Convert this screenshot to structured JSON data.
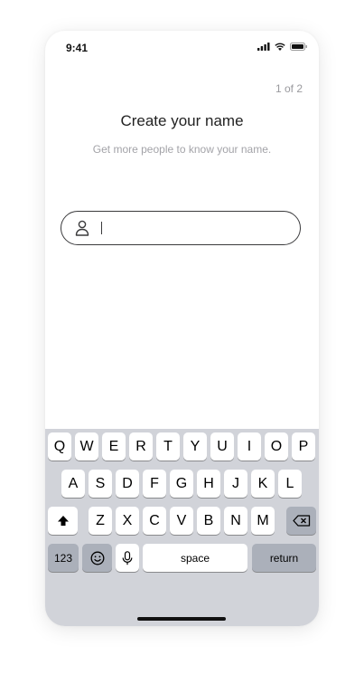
{
  "status_bar": {
    "time": "9:41",
    "icons": [
      "cellular-signal-icon",
      "wifi-icon",
      "battery-icon"
    ]
  },
  "header": {
    "step": "1 of 2"
  },
  "content": {
    "title": "Create your name",
    "subtitle": "Get more people to know your name."
  },
  "name_input": {
    "icon": "person-icon",
    "value": ""
  },
  "keyboard": {
    "row1": [
      "Q",
      "W",
      "E",
      "R",
      "T",
      "Y",
      "U",
      "I",
      "O",
      "P"
    ],
    "row2": [
      "A",
      "S",
      "D",
      "F",
      "G",
      "H",
      "J",
      "K",
      "L"
    ],
    "row3": [
      "Z",
      "X",
      "C",
      "V",
      "B",
      "N",
      "M"
    ],
    "shift_icon": "shift-up-arrow-icon",
    "delete_icon": "backspace-icon",
    "numbers_label": "123",
    "emoji_icon": "emoji-icon",
    "mic_icon": "microphone-icon",
    "space_label": "space",
    "return_label": "return"
  },
  "colors": {
    "keyboard_bg": "#d1d3d9",
    "key_light": "#ffffff",
    "key_dark": "#abb0ba",
    "field_border": "#3a3a3c",
    "subtitle_text": "#a3a3a8"
  }
}
